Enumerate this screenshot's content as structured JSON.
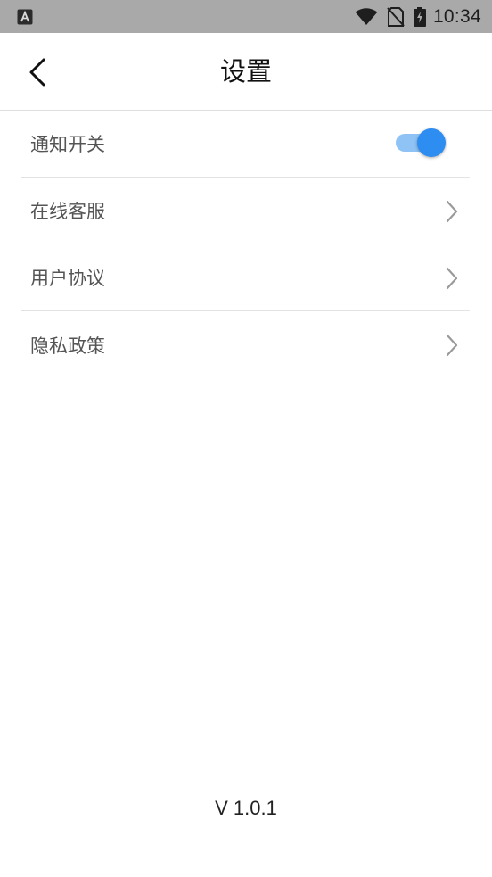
{
  "status_bar": {
    "time": "10:34",
    "icons": [
      "app-notification-icon",
      "wifi-icon",
      "no-sim-icon",
      "battery-charging-icon"
    ]
  },
  "header": {
    "back_icon": "chevron-left-icon",
    "title": "设置"
  },
  "settings": {
    "notification_toggle": {
      "label": "通知开关",
      "enabled": true
    },
    "items": [
      {
        "label": "在线客服",
        "icon": "chevron-right-icon"
      },
      {
        "label": "用户协议",
        "icon": "chevron-right-icon"
      },
      {
        "label": "隐私政策",
        "icon": "chevron-right-icon"
      }
    ]
  },
  "footer": {
    "version": "V 1.0.1"
  },
  "colors": {
    "status_bar_bg": "#a9a9a9",
    "toggle_thumb": "#2d8df0",
    "toggle_track": "#8fc3f5",
    "row_text": "#555555",
    "divider": "#e3e3e3"
  }
}
